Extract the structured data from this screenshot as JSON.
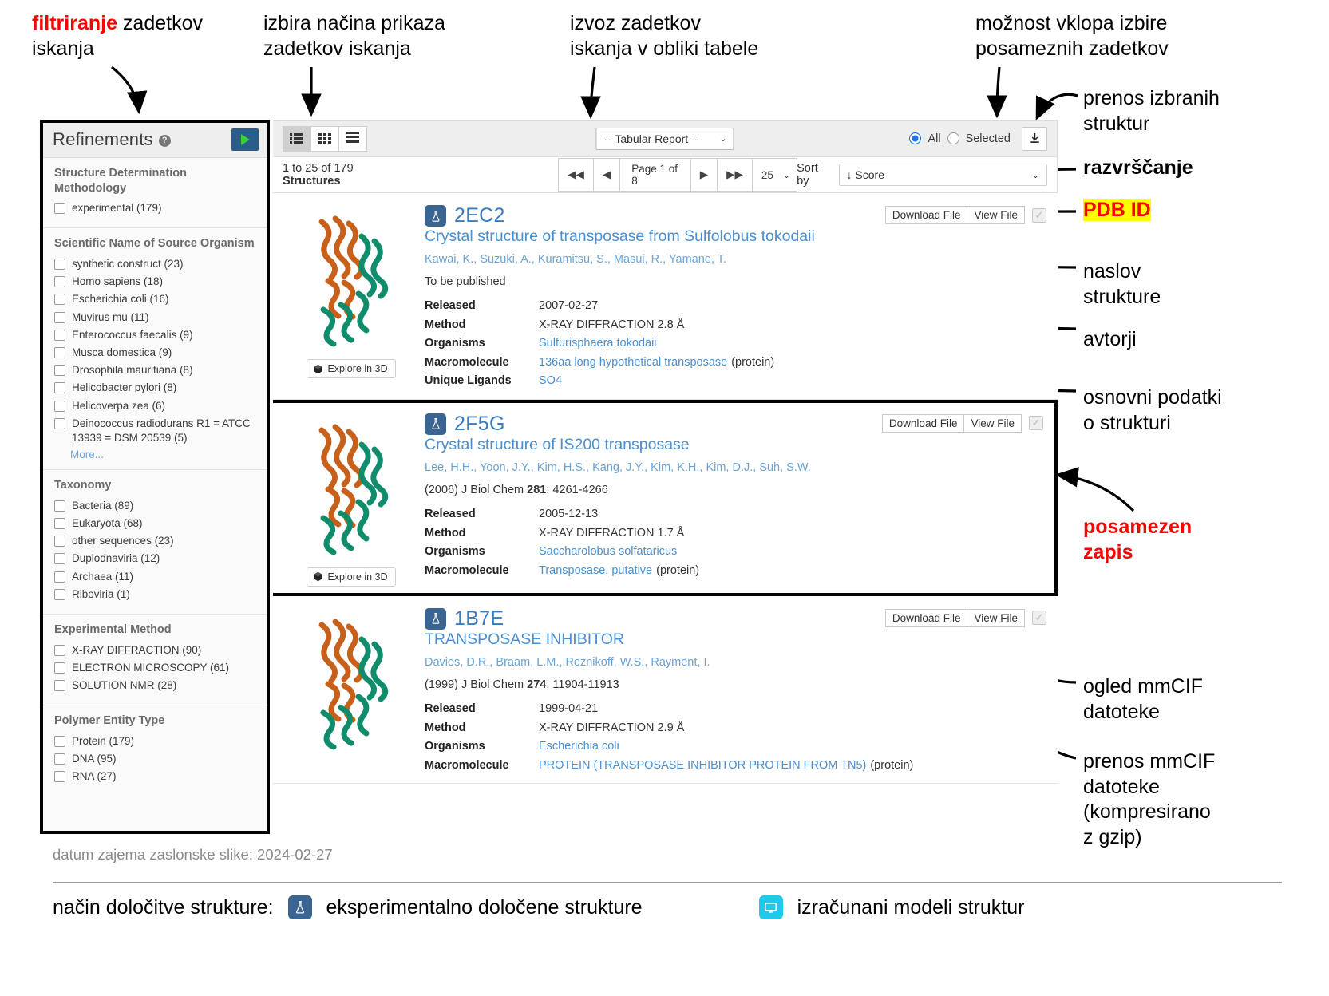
{
  "annotations": {
    "filter": {
      "red": "filtriranje",
      "rest": " zadetkov\niskanja"
    },
    "view_mode": "izbira načina prikaza\nzadetkov iskanja",
    "export": "izvoz zadetkov\niskanja v obliki tabele",
    "selection_option": "možnost vklopa izbire\nposameznih zadetkov",
    "download_selected": "prenos izbranih\nstruktur",
    "sorting": "razvrščanje",
    "pdb_id": "PDB ID",
    "title": "naslov\nstrukture",
    "authors": "avtorji",
    "basic_data": "osnovni podatki\no strukturi",
    "single_entry": "posamezen\nzapis",
    "view_mmcif": "ogled mmCIF\ndatoteke",
    "download_mmcif": "prenos mmCIF\ndatoteke\n(kompresirano\nz gzip)"
  },
  "footer": {
    "capture_note": "datum zajema zaslonske slike: 2024-02-27",
    "legend_prefix": "način določitve strukture:",
    "legend_experimental": "eksperimentalno določene strukture",
    "legend_computed": "izračunani modeli struktur"
  },
  "sidebar": {
    "header": "Refinements",
    "help_glyph": "?",
    "facets": [
      {
        "title": "Structure Determination Methodology",
        "items": [
          {
            "label": "experimental (179)"
          }
        ]
      },
      {
        "title": "Scientific Name of Source Organism",
        "items": [
          {
            "label": "synthetic construct (23)"
          },
          {
            "label": "Homo sapiens (18)"
          },
          {
            "label": "Escherichia coli (16)"
          },
          {
            "label": "Muvirus mu (11)"
          },
          {
            "label": "Enterococcus faecalis (9)"
          },
          {
            "label": "Musca domestica (9)"
          },
          {
            "label": "Drosophila mauritiana (8)"
          },
          {
            "label": "Helicobacter pylori (8)"
          },
          {
            "label": "Helicoverpa zea (6)"
          },
          {
            "label": "Deinococcus radiodurans R1 = ATCC 13939 = DSM 20539 (5)"
          }
        ],
        "more": "More..."
      },
      {
        "title": "Taxonomy",
        "items": [
          {
            "label": "Bacteria (89)"
          },
          {
            "label": "Eukaryota (68)"
          },
          {
            "label": "other sequences (23)"
          },
          {
            "label": "Duplodnaviria (12)"
          },
          {
            "label": "Archaea (11)"
          },
          {
            "label": "Riboviria (1)"
          }
        ]
      },
      {
        "title": "Experimental Method",
        "items": [
          {
            "label": "X-RAY DIFFRACTION (90)"
          },
          {
            "label": "ELECTRON MICROSCOPY (61)"
          },
          {
            "label": "SOLUTION NMR (28)"
          }
        ]
      },
      {
        "title": "Polymer Entity Type",
        "items": [
          {
            "label": "Protein (179)"
          },
          {
            "label": "DNA (95)"
          },
          {
            "label": "RNA (27)"
          }
        ]
      }
    ]
  },
  "toolbar": {
    "report_select": "-- Tabular Report --",
    "caret": "⌄",
    "radio_all": "All",
    "radio_selected": "Selected"
  },
  "pager": {
    "count_prefix": "1 to 25 of 179 ",
    "count_bold": "Structures",
    "first": "◀◀",
    "prev": "◀",
    "page_label": "Page 1 of 8",
    "next": "▶",
    "last": "▶▶",
    "per_page": "25",
    "sort_label": "Sort by",
    "sort_value": "↓ Score"
  },
  "results": [
    {
      "pdb_id": "2EC2",
      "title": "Crystal structure of transposase from Sulfolobus tokodaii",
      "authors": "Kawai, K., Suzuki, A., Kuramitsu, S., Masui, R., Yamane, T.",
      "citation_plain": "To be published",
      "citation_year": "",
      "citation_journal": "",
      "citation_volume": "",
      "citation_pages": "",
      "released": "2007-02-27",
      "method": "X-RAY DIFFRACTION 2.8 Å",
      "organisms": "Sulfurisphaera tokodaii",
      "macromolecule": "136aa long hypothetical transposase",
      "macromolecule_suffix": "(protein)",
      "ligands_key": "Unique Ligands",
      "ligands": "SO4",
      "explore_label": "Explore in 3D",
      "download_label": "Download File",
      "view_label": "View File",
      "keys": {
        "released": "Released",
        "method": "Method",
        "organisms": "Organisms",
        "macromolecule": "Macromolecule"
      }
    },
    {
      "pdb_id": "2F5G",
      "title": "Crystal structure of IS200 transposase",
      "authors": "Lee, H.H., Yoon, J.Y., Kim, H.S., Kang, J.Y., Kim, K.H., Kim, D.J., Suh, S.W.",
      "citation_plain": "",
      "citation_year": "(2006)",
      "citation_journal": "J Biol Chem",
      "citation_volume": "281",
      "citation_pages": ": 4261-4266",
      "released": "2005-12-13",
      "method": "X-RAY DIFFRACTION 1.7 Å",
      "organisms": "Saccharolobus solfataricus",
      "macromolecule": "Transposase, putative",
      "macromolecule_suffix": "(protein)",
      "ligands_key": "",
      "ligands": "",
      "explore_label": "Explore in 3D",
      "download_label": "Download File",
      "view_label": "View File",
      "keys": {
        "released": "Released",
        "method": "Method",
        "organisms": "Organisms",
        "macromolecule": "Macromolecule"
      }
    },
    {
      "pdb_id": "1B7E",
      "title": "TRANSPOSASE INHIBITOR",
      "authors": "Davies, D.R., Braam, L.M., Reznikoff, W.S., Rayment, I.",
      "citation_plain": "",
      "citation_year": "(1999)",
      "citation_journal": "J Biol Chem",
      "citation_volume": "274",
      "citation_pages": ": 11904-11913",
      "released": "1999-04-21",
      "method": "X-RAY DIFFRACTION 2.9 Å",
      "organisms": "Escherichia coli",
      "macromolecule": "PROTEIN (TRANSPOSASE INHIBITOR PROTEIN FROM TN5)",
      "macromolecule_suffix": "(protein)",
      "ligands_key": "",
      "ligands": "",
      "explore_label": "",
      "download_label": "Download File",
      "view_label": "View File",
      "keys": {
        "released": "Released",
        "method": "Method",
        "organisms": "Organisms",
        "macromolecule": "Macromolecule"
      }
    }
  ],
  "colors": {
    "accent_blue": "#3a7bbf",
    "link_blue": "#4a8fd0",
    "flask_bg": "#3a6491",
    "computed_bg": "#20c9e8",
    "annotation_red": "#ff0000",
    "highlight_yellow": "#ffff00",
    "protein_orange": "#c7601a",
    "protein_green": "#0f8c6c"
  }
}
